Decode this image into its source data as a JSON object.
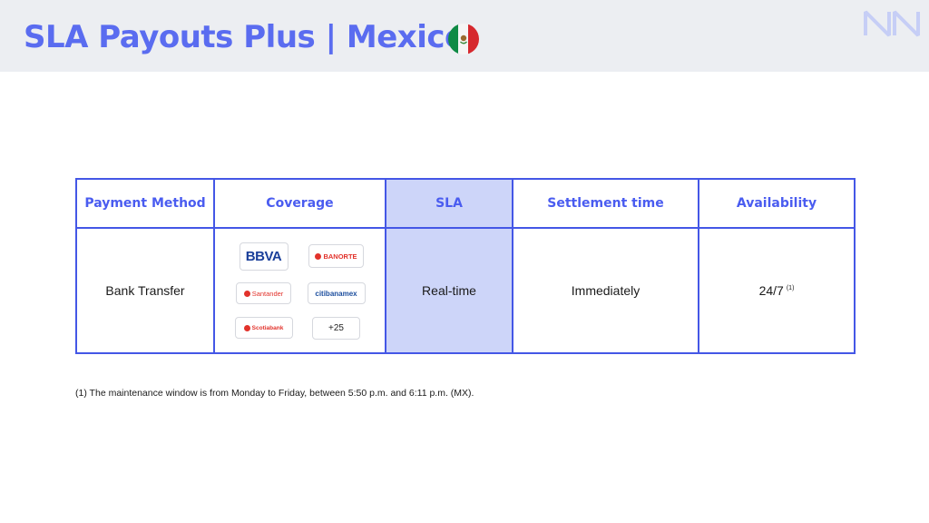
{
  "header": {
    "title": "SLA Payouts Plus | Mexico",
    "flag_icon": "mexico-flag-icon",
    "logo_icon": "brand-logo-icon",
    "colors": {
      "title": "#5a6cf0",
      "band": "#eceef2",
      "border": "#4457e6",
      "sla_highlight": "#cdd5f9"
    }
  },
  "table": {
    "headers": [
      "Payment Method",
      "Coverage",
      "SLA",
      "Settlement time",
      "Availability"
    ],
    "row": {
      "method": "Bank Transfer",
      "coverage": {
        "banks": [
          "BBVA",
          "BANORTE",
          "Santander",
          "citibanamex",
          "Scotiabank"
        ],
        "more": "+25"
      },
      "sla": "Real-time",
      "settlement": "Immediately",
      "availability": "24/7",
      "availability_note": "(1)"
    }
  },
  "footnote": "(1) The maintenance window is from Monday to Friday, between 5:50 p.m. and 6:11 p.m. (MX)."
}
